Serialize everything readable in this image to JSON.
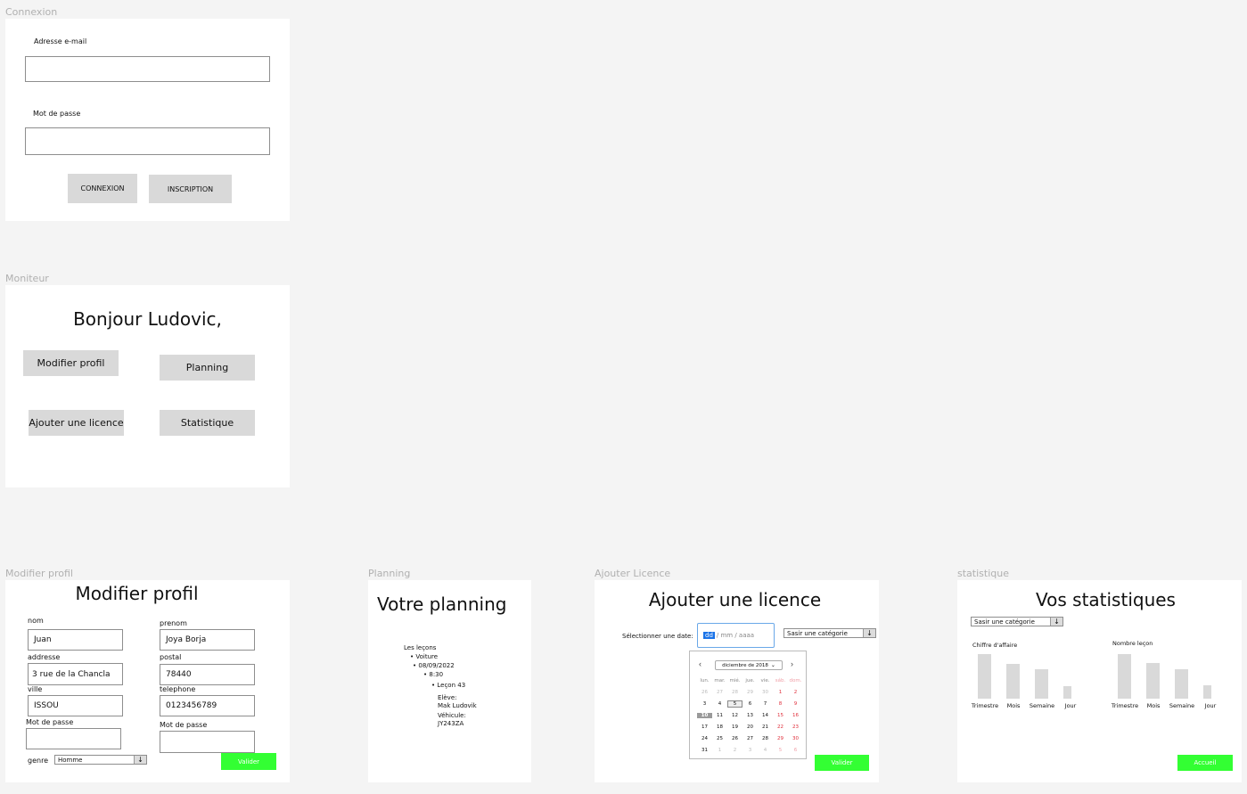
{
  "connexion": {
    "frame_label": "Connexion",
    "email_label": "Adresse e-mail",
    "password_label": "Mot de passe",
    "login_button": "CONNEXION",
    "register_button": "INSCRIPTION"
  },
  "moniteur": {
    "frame_label": "Moniteur",
    "greeting": "Bonjour Ludovic,",
    "buttons": {
      "edit_profile": "Modifier profil",
      "planning": "Planning",
      "add_license": "Ajouter une licence",
      "statistics": "Statistique"
    }
  },
  "modifier_profil": {
    "frame_label": "Modifier profil",
    "title": "Modifier profil",
    "fields": {
      "nom": {
        "label": "nom",
        "value": "Juan"
      },
      "prenom": {
        "label": "prenom",
        "value": "Joya Borja"
      },
      "address": {
        "label": "addresse",
        "value": "3 rue de la Chancla"
      },
      "postal": {
        "label": "postal",
        "value": "78440"
      },
      "ville": {
        "label": "ville",
        "value": "ISSOU"
      },
      "telephone": {
        "label": "telephone",
        "value": "0123456789"
      },
      "password_left": {
        "label": "Mot de passe",
        "value": ""
      },
      "password_right": {
        "label": "Mot de passe",
        "value": ""
      }
    },
    "genre_label": "genre",
    "genre_value": "Homme",
    "submit": "Valider"
  },
  "planning": {
    "frame_label": "Planning",
    "title": "Votre planning",
    "tree": {
      "root": "Les leçons",
      "vehicle_type": "Voiture",
      "date": "08/09/2022",
      "time": "8:30",
      "lesson": "Leçon 43",
      "student_label": "Elève:",
      "student": "Mak Ludovik",
      "vehicle_label": "Véhicule:",
      "vehicle": "JY243ZA"
    }
  },
  "ajouter_licence": {
    "frame_label": "Ajouter Licence",
    "title": "Ajouter une licence",
    "date_label": "Sélectionner une date:",
    "date_placeholder": {
      "dd": "dd",
      "rest": "/ mm / aaaa"
    },
    "category_select": "Sasir une catégorie",
    "calendar": {
      "month": "diciembre de 2018",
      "day_names": [
        "lun.",
        "mar.",
        "mié.",
        "jue.",
        "vie.",
        "sáb.",
        "dom."
      ],
      "weeks": [
        [
          "26",
          "27",
          "28",
          "29",
          "30",
          "1",
          "2"
        ],
        [
          "3",
          "4",
          "5",
          "6",
          "7",
          "8",
          "9"
        ],
        [
          "10",
          "11",
          "12",
          "13",
          "14",
          "15",
          "16"
        ],
        [
          "17",
          "18",
          "19",
          "20",
          "21",
          "22",
          "23"
        ],
        [
          "24",
          "25",
          "26",
          "27",
          "28",
          "29",
          "30"
        ],
        [
          "31",
          "1",
          "2",
          "3",
          "4",
          "5",
          "6"
        ]
      ],
      "selected_day": "10",
      "today": "5"
    },
    "submit": "Valider"
  },
  "statistique": {
    "frame_label": "statistique",
    "title": "Vos statistiques",
    "category_select": "Sasir une catégorie",
    "charts": [
      {
        "title": "Chiffre d'affaire",
        "categories": [
          "Trimestre",
          "Mois",
          "Semaine",
          "Jour"
        ],
        "values": [
          100,
          77,
          65,
          28
        ]
      },
      {
        "title": "Nombre leçon",
        "categories": [
          "Trimestre",
          "Mois",
          "Semaine",
          "Jour"
        ],
        "values": [
          100,
          80,
          66,
          30
        ]
      }
    ],
    "submit": "Accueil"
  },
  "colors": {
    "accent_green": "#33ff33",
    "button_gray": "#d9d9d9",
    "weekend_red": "#e0303c"
  }
}
